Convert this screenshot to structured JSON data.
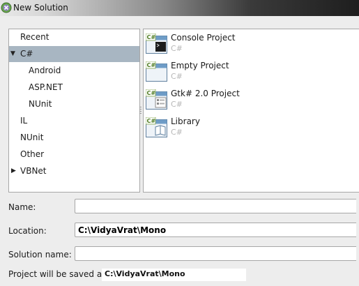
{
  "window": {
    "title": "New Solution"
  },
  "tree": {
    "items": [
      {
        "label": "Recent",
        "expander": ""
      },
      {
        "label": "C#",
        "expander": "▼"
      },
      {
        "label": "Android",
        "expander": ""
      },
      {
        "label": "ASP.NET",
        "expander": ""
      },
      {
        "label": "NUnit",
        "expander": ""
      },
      {
        "label": "IL",
        "expander": ""
      },
      {
        "label": "NUnit",
        "expander": ""
      },
      {
        "label": "Other",
        "expander": ""
      },
      {
        "label": "VBNet",
        "expander": "▶"
      }
    ],
    "selected": "C#"
  },
  "templates": {
    "items": [
      {
        "name": "Console Project",
        "language": "C#",
        "icon": "console-project-icon"
      },
      {
        "name": "Empty Project",
        "language": "C#",
        "icon": "empty-project-icon"
      },
      {
        "name": "Gtk# 2.0 Project",
        "language": "C#",
        "icon": "gtk-project-icon"
      },
      {
        "name": "Library",
        "language": "C#",
        "icon": "library-project-icon"
      }
    ],
    "icon_badge": "C#"
  },
  "form": {
    "name_label": "Name:",
    "name_value": "",
    "location_label": "Location:",
    "location_value": "C:\\VidyaVrat\\Mono",
    "solution_label": "Solution name:",
    "solution_value": "",
    "saved_prefix": "Project will be saved at",
    "saved_path": "C:\\VidyaVrat\\Mono"
  },
  "colors": {
    "selection": "#a8b6c2",
    "panel_border": "#a7a7a7",
    "dialog_bg": "#ededed",
    "secondary_text": "#b7b7b7"
  }
}
